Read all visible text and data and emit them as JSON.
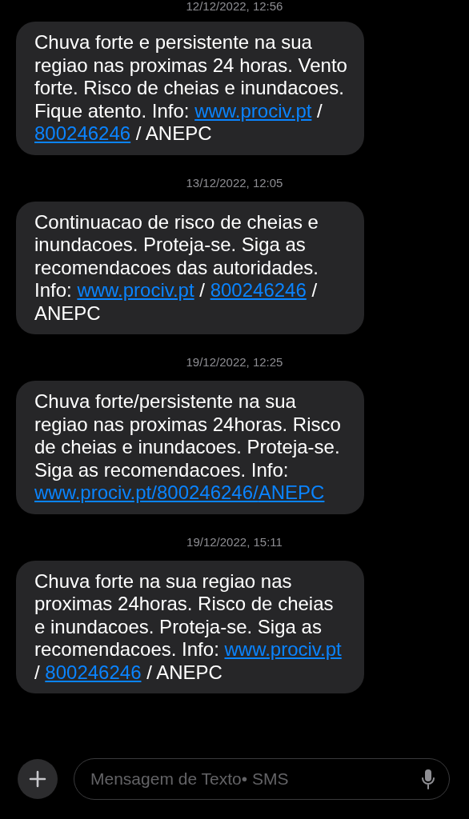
{
  "messages": [
    {
      "timestamp": "12/12/2022, 12:56",
      "segments": [
        {
          "kind": "text",
          "text": "Chuva forte e persistente na sua regiao nas proximas 24 horas. Vento forte. Risco de cheias e inundacoes. Fique atento. Info: "
        },
        {
          "kind": "link",
          "text": "www.prociv.pt"
        },
        {
          "kind": "text",
          "text": " / "
        },
        {
          "kind": "link",
          "text": "800246246"
        },
        {
          "kind": "text",
          "text": " / ANEPC"
        }
      ]
    },
    {
      "timestamp": "13/12/2022, 12:05",
      "segments": [
        {
          "kind": "text",
          "text": "Continuacao de risco de cheias e inundacoes. Proteja-se. Siga as recomendacoes das autoridades. Info: "
        },
        {
          "kind": "link",
          "text": "www.prociv.pt"
        },
        {
          "kind": "text",
          "text": " / "
        },
        {
          "kind": "link",
          "text": "800246246"
        },
        {
          "kind": "text",
          "text": " / ANEPC"
        }
      ]
    },
    {
      "timestamp": "19/12/2022, 12:25",
      "segments": [
        {
          "kind": "text",
          "text": "Chuva forte/persistente na sua regiao nas proximas 24horas. Risco de cheias e inundacoes. Proteja-se. Siga as recomendacoes. Info:"
        },
        {
          "kind": "link",
          "text": "www.prociv.pt/800246246/"
        },
        {
          "kind": "link",
          "text": "ANEPC"
        }
      ]
    },
    {
      "timestamp": "19/12/2022, 15:11",
      "segments": [
        {
          "kind": "text",
          "text": "Chuva forte na sua regiao nas proximas 24horas. Risco de cheias e inundacoes. Proteja-se. Siga as recomendacoes. Info: "
        },
        {
          "kind": "link",
          "text": "www.prociv.pt"
        },
        {
          "kind": "text",
          "text": " / "
        },
        {
          "kind": "link",
          "text": "800246246"
        },
        {
          "kind": "text",
          "text": " / ANEPC"
        }
      ]
    }
  ],
  "composer": {
    "placeholder": "Mensagem de Texto• SMS"
  }
}
